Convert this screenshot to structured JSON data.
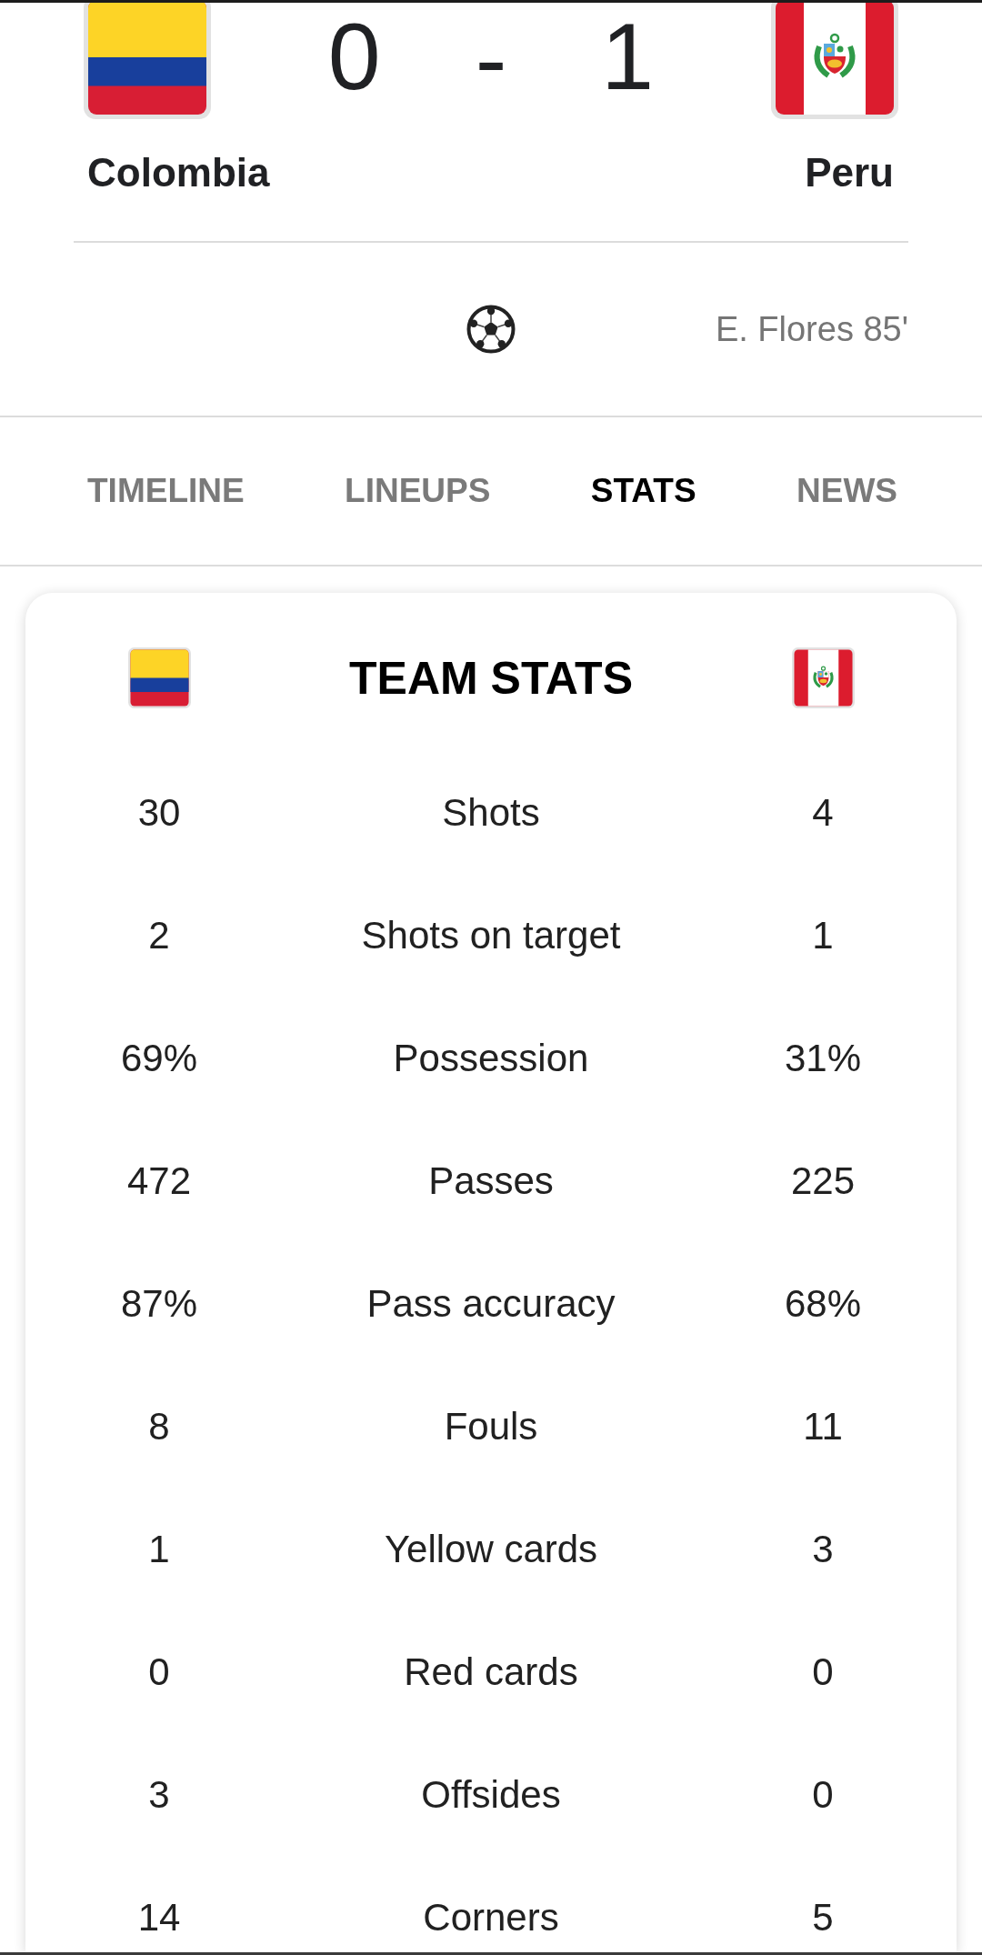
{
  "match": {
    "teams": [
      {
        "name": "Colombia"
      },
      {
        "name": "Peru",
        "goals": [
          "E. Flores 85'"
        ]
      }
    ],
    "score": {
      "home": "0",
      "separator": "-",
      "away": "1"
    }
  },
  "tabs": [
    {
      "label": "TIMELINE",
      "selected": false
    },
    {
      "label": "LINEUPS",
      "selected": false
    },
    {
      "label": "STATS",
      "selected": true
    },
    {
      "label": "NEWS",
      "selected": false
    }
  ],
  "team_stats": {
    "title": "TEAM STATS",
    "rows": [
      {
        "label": "Shots",
        "home": "30",
        "away": "4"
      },
      {
        "label": "Shots on target",
        "home": "2",
        "away": "1"
      },
      {
        "label": "Possession",
        "home": "69%",
        "away": "31%"
      },
      {
        "label": "Passes",
        "home": "472",
        "away": "225"
      },
      {
        "label": "Pass accuracy",
        "home": "87%",
        "away": "68%"
      },
      {
        "label": "Fouls",
        "home": "8",
        "away": "11"
      },
      {
        "label": "Yellow cards",
        "home": "1",
        "away": "3"
      },
      {
        "label": "Red cards",
        "home": "0",
        "away": "0"
      },
      {
        "label": "Offsides",
        "home": "3",
        "away": "0"
      },
      {
        "label": "Corners",
        "home": "14",
        "away": "5"
      }
    ]
  }
}
